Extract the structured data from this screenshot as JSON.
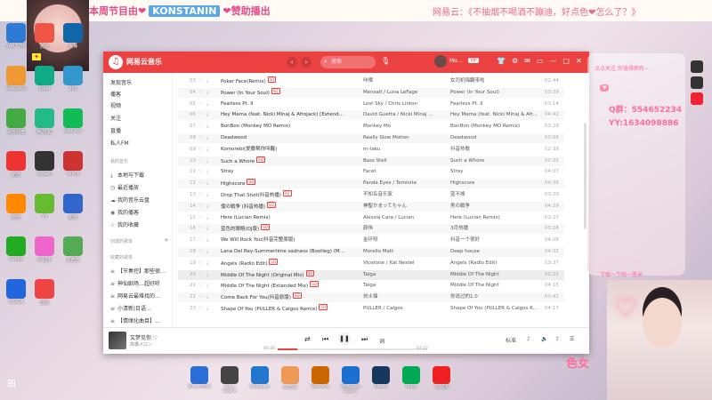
{
  "stream": {
    "left_banner": "本周节目由❤",
    "sponsor": "KONSTANIN",
    "left_banner_tail": "❤赞助播出",
    "right_banner": "网易云：《不抽烟不喝酒不蹦迪，好点色❤怎么了？》",
    "follow_text": "点点关注 你值得拥有~",
    "qq_label": "Q群：",
    "qq_value": "554652234",
    "yy_label": "YY:",
    "yy_value": "1634098886",
    "mic_text": "下载一下喷一厘米",
    "girl_text": "色女"
  },
  "player": {
    "app_title": "网易云音乐",
    "search_placeholder": "搜索",
    "username": "Mo…",
    "vip": "VIP"
  },
  "sidebar": {
    "items": [
      {
        "label": "发现音乐"
      },
      {
        "label": "播客"
      },
      {
        "label": "视频"
      },
      {
        "label": "关注"
      },
      {
        "label": "直播"
      },
      {
        "label": "私人FM"
      }
    ],
    "section_mine": "我的音乐",
    "mine_items": [
      {
        "label": "本地与下载"
      },
      {
        "label": "最近播放"
      },
      {
        "label": "我的音乐云盘"
      },
      {
        "label": "我的播客"
      },
      {
        "label": "我的收藏"
      }
    ],
    "section_created": "创建的歌单",
    "section_collected": "收藏的歌单",
    "collected_items": [
      {
        "label": "【节奏控】那些很…"
      },
      {
        "label": "神仙剧场…超好听"
      },
      {
        "label": "网易云最难找的…"
      },
      {
        "label": "小清新|日语…"
      },
      {
        "label": "【情绪化曲目】…"
      }
    ]
  },
  "tracks": [
    {
      "idx": "03",
      "title": "Poker Face(Remix)",
      "tag": "SQ",
      "artist": "咔噗",
      "album": "女司机嗨翻来啦",
      "dur": "02:44"
    },
    {
      "idx": "04",
      "title": "Power (In Your Soul)",
      "tag": "SQ",
      "artist": "Mensalt / Luna LeFage",
      "album": "Power (In Your Soul)",
      "dur": "03:29"
    },
    {
      "idx": "05",
      "title": "Fearless Pt. II",
      "tag": "",
      "artist": "Lost Sky / Chris Linton",
      "album": "Fearless Pt. II",
      "dur": "03:14"
    },
    {
      "idx": "06",
      "title": "Hey Mama (feat. Nicki Minaj & Afrojack) [Extended]",
      "tag": "",
      "artist": "David Guetta / Nicki Minaj / A…",
      "album": "Hey Mama (feat. Nicki Minaj & Afrojack) [..]",
      "dur": "04:42"
    },
    {
      "idx": "07",
      "title": "BonBon (Monkey MO Remix)",
      "tag": "",
      "artist": "Monkey Mo",
      "album": "BonBon (Monkey MO Remix)",
      "dur": "03:29"
    },
    {
      "idx": "08",
      "title": "Deadwood",
      "tag": "",
      "artist": "Really Slow Motion",
      "album": "Deadwood",
      "dur": "03:08"
    },
    {
      "idx": "09",
      "title": "Komorebi(爱撒帮你叫醒)",
      "tag": "",
      "artist": "m-taku",
      "album": "抖音热歌",
      "dur": "02:39"
    },
    {
      "idx": "10",
      "title": "Such a Whore",
      "tag": "SQ",
      "artist": "Bass Stell",
      "album": "Such a Whore",
      "dur": "02:05"
    },
    {
      "idx": "11",
      "title": "Stray",
      "tag": "",
      "artist": "Facet",
      "album": "Stray",
      "dur": "04:07"
    },
    {
      "idx": "12",
      "title": "Highscore",
      "tag": "SQ",
      "artist": "Panda Eyes / Teminite",
      "album": "Highscore",
      "dur": "04:36"
    },
    {
      "idx": "13",
      "title": "Drop That Shot(抖音热播)",
      "tag": "SQ",
      "artist": "不知名音乐家",
      "album": "蓝不掉",
      "dur": "03:20"
    },
    {
      "idx": "14",
      "title": "僕の戦争 (抖音热播)",
      "tag": "SQ",
      "artist": "神聖かまってちゃん",
      "album": "男の戦争",
      "dur": "04:29"
    },
    {
      "idx": "15",
      "title": "Here (Lucian Remix)",
      "tag": "",
      "artist": "Alessia Cara / Lucian",
      "album": "Here (Lucian Remix)",
      "dur": "03:27"
    },
    {
      "idx": "16",
      "title": "蓝色的眼睛(DJ版)",
      "tag": "SQ",
      "artist": "颜伟",
      "album": "3月热播",
      "dur": "03:28"
    },
    {
      "idx": "17",
      "title": "We Will Rock You(抖音完整原版)",
      "tag": "",
      "artist": "金环呀",
      "album": "抖音一个很好",
      "dur": "04:08"
    },
    {
      "idx": "18",
      "title": "Lana Del Rey-Summertime sadness (Bootleg) (Morello Matt re…",
      "tag": "",
      "artist": "Morello Matt",
      "album": "Deep house",
      "dur": "04:32"
    },
    {
      "idx": "19",
      "title": "Angels (Radio Edit)",
      "tag": "SQ",
      "artist": "Vicetone / Kat Nestel",
      "album": "Angels (Radio Edit)",
      "dur": "03:37"
    },
    {
      "idx": "20",
      "title": "Middle Of The Night (Original Mix)",
      "tag": "SQ",
      "artist": "Taiga",
      "album": "Middle Of The Night",
      "dur": "03:22"
    },
    {
      "idx": "21",
      "title": "Middle Of The Night (Extended Mix)",
      "tag": "SQ",
      "artist": "Taiga",
      "album": "Middle Of The Night",
      "dur": "04:15"
    },
    {
      "idx": "22",
      "title": "Come Back For You(抖音原版)",
      "tag": "SQ",
      "artist": "刘士锋",
      "album": "你说过的1.0",
      "dur": "03:42"
    },
    {
      "idx": "23",
      "title": "Shape Of You (PULLER & Calgos Remix)",
      "tag": "SQ",
      "artist": "PULLER / Calgos",
      "album": "Shape Of You (PULLER & Calgos Remix)",
      "dur": "04:17"
    }
  ],
  "now_playing": {
    "title": "又梦见你 ♡",
    "artist": "高橋メロン",
    "time_current": "00:26",
    "time_total": "03:22",
    "progress_fraction": 0.13,
    "quality": "标准",
    "lyric_btn": "词"
  },
  "desktop_icons": [
    "Win7 Pro",
    "微软",
    "夜神",
    "WeGame",
    "Edge",
    "360",
    "百度网盘",
    "腾讯QQ",
    "WeChat",
    "酷狗",
    "Steam",
    "Twitch",
    "雷电",
    "YY",
    "迅雷",
    "Nvidia",
    "PP助手",
    "爱奇艺",
    "ToDesk",
    "剪映"
  ],
  "taskbar_apps": [
    "StreamWall",
    "Steel Engine",
    "Wallpaper",
    "QQ音乐",
    "WeGame",
    "Wallpaper Engine",
    "Steam",
    "Uplay",
    "UU加速"
  ]
}
